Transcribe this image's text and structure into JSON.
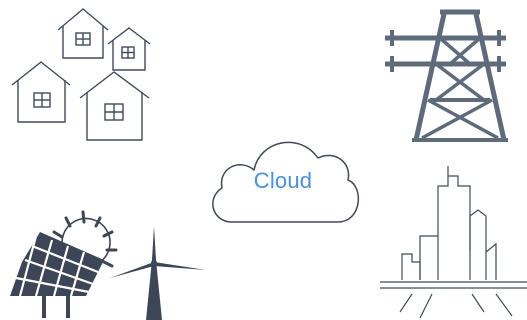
{
  "cloud": {
    "label": "Cloud"
  },
  "icons": [
    {
      "name": "houses-icon"
    },
    {
      "name": "transmission-tower-icon"
    },
    {
      "name": "cloud-icon"
    },
    {
      "name": "solar-panel-icon"
    },
    {
      "name": "wind-turbine-icon"
    },
    {
      "name": "city-buildings-icon"
    }
  ],
  "colors": {
    "line": "#3f4a59",
    "tower": "#5f6b7a",
    "cloud_text": "#4a90d9",
    "solar": "#3c4656"
  }
}
